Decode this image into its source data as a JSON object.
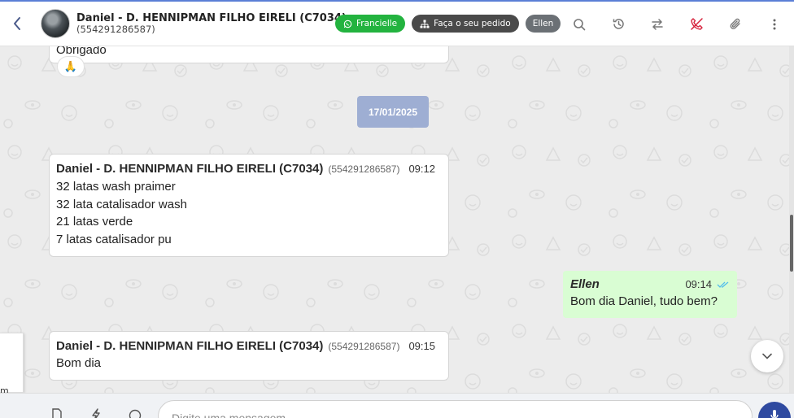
{
  "header": {
    "contact_name": "Daniel - D. HENNIPMAN FILHO EIRELI (C7034)",
    "contact_phone": "(554291286587)",
    "pill_agent": "Francielle",
    "pill_order": "Faça o seu pedido",
    "pill_user": "Ellen",
    "icons": [
      "back-arrow-icon",
      "whatsapp-icon",
      "sitemap-icon",
      "search-icon",
      "history-icon",
      "transfer-icon",
      "end-call-icon",
      "paperclip-icon",
      "more-vertical-icon"
    ]
  },
  "colors": {
    "pill_green": "#23b33f",
    "pill_dark": "#4a4a4a",
    "date_chip": "#9eaed3",
    "outgoing_bubble": "#d9fdd3",
    "header_accent": "#5b7fd6",
    "read_ticks": "#53bdeb",
    "end_call_red": "#d6213b"
  },
  "chat": {
    "prev_message_text": "Obrigado",
    "prev_reaction": "🙏",
    "date_separator": "17/01/2025",
    "messages": [
      {
        "sender": "Daniel - D. HENNIPMAN FILHO EIRELI (C7034)",
        "phone": "(554291286587)",
        "time": "09:12",
        "lines": [
          "32 latas wash praimer",
          "32 lata catalisador wash",
          "21 latas verde",
          "7 latas catalisador pu"
        ]
      },
      {
        "sender": "Ellen",
        "time": "09:14",
        "lines": [
          "Bom dia Daniel, tudo bem?"
        ]
      },
      {
        "sender": "Daniel - D. HENNIPMAN FILHO EIRELI (C7034)",
        "phone": "(554291286587)",
        "time": "09:15",
        "lines": [
          "Bom dia"
        ]
      }
    ],
    "side_panel_text": "m o"
  },
  "composer": {
    "placeholder": "Digite uma mensagem",
    "icons": [
      "document-icon",
      "lightning-icon",
      "emoji-icon",
      "microphone-icon"
    ]
  }
}
